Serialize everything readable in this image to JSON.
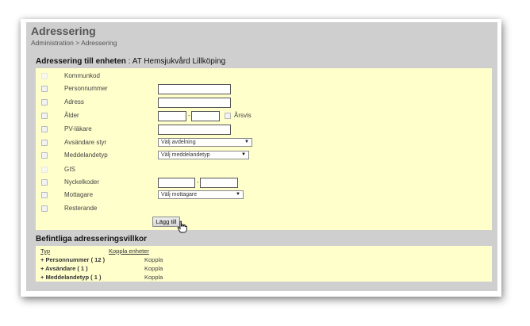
{
  "header": {
    "title": "Adressering",
    "breadcrumb": "Administration > Adressering"
  },
  "form_section": {
    "title_prefix": "Adressering till enheten",
    "title_unit": " : AT Hemsjukvård Lillköping"
  },
  "form": {
    "rows": [
      {
        "label": "Kommunkod"
      },
      {
        "label": "Personnummer"
      },
      {
        "label": "Adress"
      },
      {
        "label": "Ålder",
        "extra_label": "Årsvis"
      },
      {
        "label": "PV-läkare"
      },
      {
        "label": "Avsändare styr",
        "select": "Välj avdelning"
      },
      {
        "label": "Meddelandetyp",
        "select": "Välj meddelandetyp"
      },
      {
        "label": "GIS"
      },
      {
        "label": "Nyckelkoder"
      },
      {
        "label": "Mottagare",
        "select": "Välj mottagare"
      },
      {
        "label": "Resterande"
      }
    ],
    "range_separator": "-",
    "add_button": "Lägg till"
  },
  "list_section": {
    "title": "Befintliga adresseringsvillkor",
    "columns": [
      "Typ",
      "Koppla enheter"
    ],
    "rows": [
      {
        "name": "+ Personnummer ( 12 )",
        "action": "Koppla"
      },
      {
        "name": "+ Avsändare ( 1 )",
        "action": "Koppla"
      },
      {
        "name": "+ Meddelandetyp ( 1 )",
        "action": "Koppla"
      }
    ]
  },
  "icons": {
    "cursor": "hand-pointer-icon",
    "dropdown": "chevron-down-icon"
  },
  "colors": {
    "panel_bg": "#ffffcc",
    "page_bg": "#cfcfcf"
  }
}
